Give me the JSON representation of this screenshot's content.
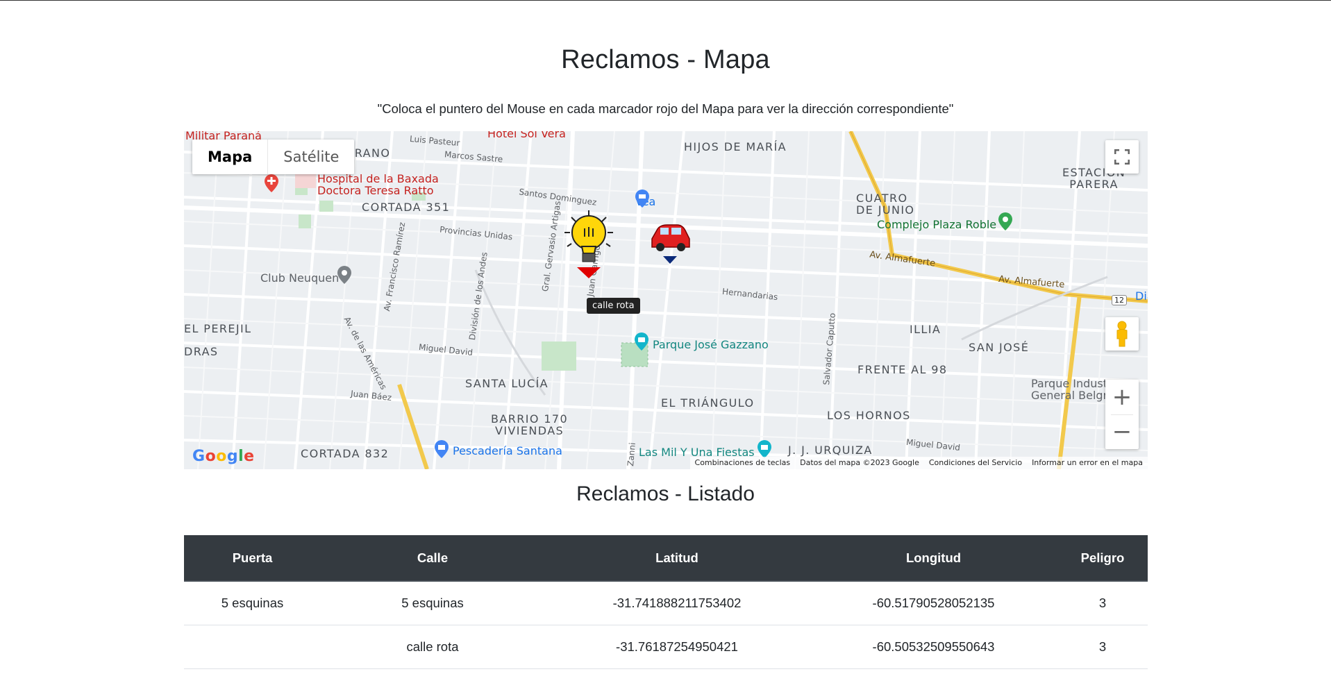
{
  "page": {
    "title": "Reclamos - Mapa",
    "subtitle": "\"Coloca el puntero del Mouse en cada marcador rojo del Mapa para ver la dirección correspondiente\""
  },
  "map": {
    "maptype": {
      "map_label": "Mapa",
      "satellite_label": "Satélite",
      "selected": "Mapa"
    },
    "controls": {
      "zoom_in": "+",
      "zoom_out": "−"
    },
    "tooltip": "calle rota",
    "markers": [
      {
        "name": "lightbulb-marker",
        "color": "#e00000"
      },
      {
        "name": "car-marker",
        "color": "#0b2a7a"
      }
    ],
    "labels": {
      "militar_parana": "Militar Paraná",
      "hotel_sol_vera": "Hotel Sol Vera",
      "granado": "GRANO",
      "luis_pasteur": "Luis Pasteur",
      "marcos_sastre": "Marcos Sastre",
      "hijos_de_maria": "HIJOS DE MARÍA",
      "hospital": "Hospital de la Baxada",
      "hospital2": "Doctora Teresa Ratto",
      "santos_dominguez": "Santos Dominguez",
      "vea": "Vea",
      "cortada_351": "CORTADA 351",
      "cuatro": "CUATRO",
      "de_junio": "DE JUNIO",
      "estacion": "ESTACIÓN",
      "parera": "PARERA",
      "complejo": "Complejo Plaza Roble",
      "provincias_unidas": "Provincias Unidas",
      "av_almafuerte1": "Av. Almafuerte",
      "av_almafuerte2": "Av. Almafuerte",
      "club_neuquen": "Club Neuquen",
      "hernandarias": "Hernandarias",
      "el_perejil": "EL PEREJIL",
      "dras": "DRAS",
      "illia": "ILLIA",
      "san_jose": "SAN JOSÉ",
      "parque_gazzano": "Parque José Gazzano",
      "miguel_david": "Miguel David",
      "frente_al_98": "FRENTE AL 98",
      "parque_indust1": "Parque Indust",
      "parque_indust2": "General Belgra",
      "santa_lucia": "SANTA LUCÍA",
      "el_triangulo": "EL TRIÁNGULO",
      "juan_baez": "Juan Báez",
      "barrio_170": "BARRIO 170",
      "viviendas": "VIVIENDAS",
      "los_hornos": "LOS HORNOS",
      "cortada_832": "CORTADA 832",
      "pescaderia": "Pescadería Santana",
      "las_mil": "Las Mil Y Una Fiestas",
      "jj_urquiza": "J. J. URQUIZA",
      "miguel_david2": "Miguel David",
      "av_francisco": "Av. Francisco Ramírez",
      "division": "División de los Andes",
      "gral_gervasio": "Gral. Gervasio Artigas",
      "juan_garrigo": "Juan Garrigó",
      "av_americas": "Av. de las Américas",
      "salvador_caputto": "Salvador Caputto",
      "zanni": "Zanni",
      "route_12": "12",
      "dia": "Dia"
    },
    "attribution": {
      "shortcuts": "Combinaciones de teclas",
      "data": "Datos del mapa ©2023 Google",
      "terms": "Condiciones del Servicio",
      "report": "Informar un error en el mapa"
    },
    "google_logo": "Google"
  },
  "list": {
    "title": "Reclamos - Listado",
    "headers": [
      "Puerta",
      "Calle",
      "Latitud",
      "Longitud",
      "Peligro"
    ],
    "rows": [
      [
        "5 esquinas",
        "5 esquinas",
        "-31.741888211753402",
        "-60.51790528052135",
        "3"
      ],
      [
        "",
        "calle rota",
        "-31.76187254950421",
        "-60.50532509550643",
        "3"
      ]
    ]
  }
}
